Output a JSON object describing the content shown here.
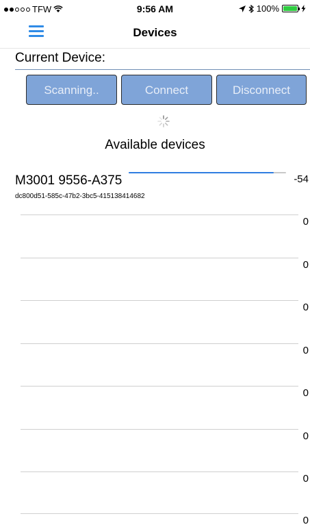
{
  "status_bar": {
    "carrier": "TFW",
    "time": "9:56 AM",
    "battery": "100%",
    "signal_bars_filled": 2,
    "signal_bars_total": 5
  },
  "nav": {
    "title": "Devices",
    "menu_icon": "hamburger-menu-icon"
  },
  "current_device_label": "Current Device:",
  "buttons": {
    "scan": "Scanning..",
    "connect": "Connect",
    "disconnect": "Disconnect"
  },
  "available_heading": "Available devices",
  "devices": [
    {
      "name": "M3001 9556-A375",
      "uuid": "dc800d51-585c-47b2-3bc5-415138414682",
      "rssi": "-54",
      "signal_level": 0.92
    }
  ],
  "empty_rows": [
    "0",
    "0",
    "0",
    "0",
    "0",
    "0",
    "0",
    "0"
  ],
  "colors": {
    "accent": "#2f8be6",
    "button_bg": "#7fa4d8",
    "battery": "#2ecc40"
  }
}
